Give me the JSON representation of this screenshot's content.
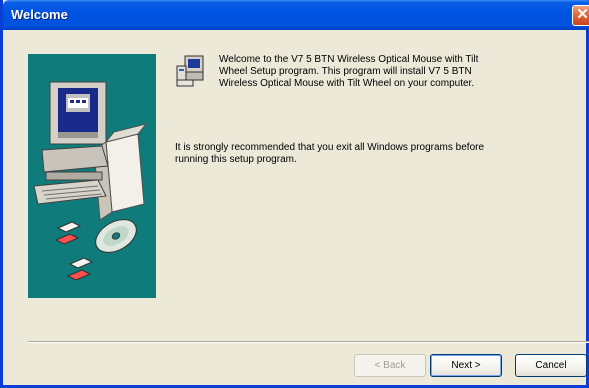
{
  "window": {
    "title": "Welcome",
    "close_glyph": "✕"
  },
  "content": {
    "welcome_text": "Welcome to the V7 5 BTN Wireless Optical Mouse with Tilt Wheel Setup program.  This program will install V7 5 BTN Wireless Optical Mouse with Tilt Wheel on your computer.",
    "recommend_text": "It is strongly recommended that you exit all Windows programs before running this setup program."
  },
  "buttons": {
    "back_label": "< Back",
    "next_label": "Next >",
    "cancel_label": "Cancel"
  },
  "icons": {
    "setup": "computer-setup-icon",
    "art": "computer-box-cd-illustration"
  },
  "colors": {
    "titlebar": "#0054e3",
    "side_panel": "#107b7b",
    "dialog_bg": "#ece9d8",
    "close_button": "#e1613a"
  }
}
